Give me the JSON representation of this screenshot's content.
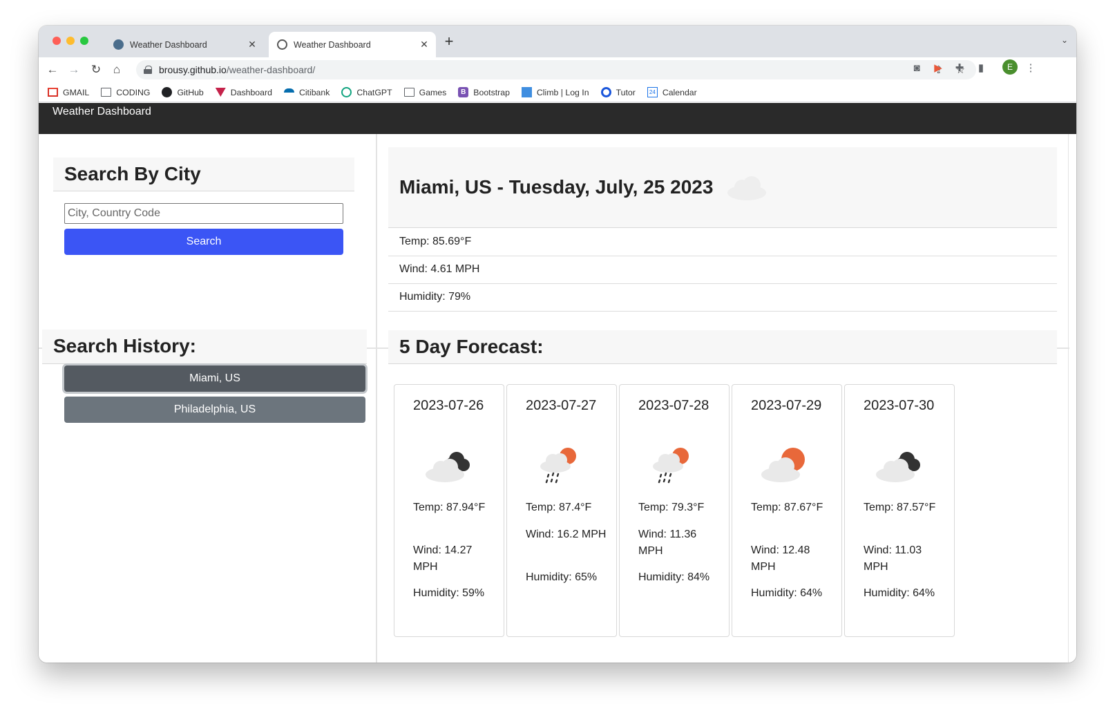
{
  "browser": {
    "tabs": [
      {
        "title": "Weather Dashboard",
        "active": false
      },
      {
        "title": "Weather Dashboard",
        "active": true
      }
    ],
    "url_host": "brousy.github.io",
    "url_path": "/weather-dashboard/",
    "profile_initial": "E",
    "bookmarks": [
      {
        "label": "GMAIL",
        "icon": "gmail-icon"
      },
      {
        "label": "CODING",
        "icon": "folder-icon"
      },
      {
        "label": "GitHub",
        "icon": "github-icon"
      },
      {
        "label": "Dashboard",
        "icon": "dashboard-icon"
      },
      {
        "label": "Citibank",
        "icon": "citibank-icon"
      },
      {
        "label": "ChatGPT",
        "icon": "chatgpt-icon"
      },
      {
        "label": "Games",
        "icon": "folder-icon"
      },
      {
        "label": "Bootstrap",
        "icon": "bootstrap-icon"
      },
      {
        "label": "Climb | Log In",
        "icon": "climb-icon"
      },
      {
        "label": "Tutor",
        "icon": "tutor-icon"
      },
      {
        "label": "Calendar",
        "icon": "calendar-icon"
      }
    ]
  },
  "app": {
    "brand": "Weather Dashboard",
    "search": {
      "heading": "Search By City",
      "placeholder": "City, Country Code",
      "value": "",
      "button_label": "Search"
    },
    "history": {
      "heading": "Search History:",
      "items": [
        "Miami, US",
        "Philadelphia, US"
      ],
      "selected_index": 0
    },
    "current": {
      "title": "Miami, US - Tuesday, July, 25 2023",
      "icon": "cloud-icon",
      "temp": "Temp: 85.69°F",
      "wind": "Wind: 4.61 MPH",
      "humidity": "Humidity: 79%"
    },
    "forecast": {
      "heading": "5 Day Forecast:",
      "days": [
        {
          "date": "2023-07-26",
          "icon": "broken-clouds-icon",
          "temp": "Temp: 87.94°F",
          "wind": "Wind: 14.27 MPH",
          "humidity": "Humidity: 59%"
        },
        {
          "date": "2023-07-27",
          "icon": "rain-sun-icon",
          "temp": "Temp: 87.4°F",
          "wind": "Wind: 16.2 MPH",
          "humidity": "Humidity: 65%"
        },
        {
          "date": "2023-07-28",
          "icon": "rain-sun-icon",
          "temp": "Temp: 79.3°F",
          "wind": "Wind: 11.36 MPH",
          "humidity": "Humidity: 84%"
        },
        {
          "date": "2023-07-29",
          "icon": "partly-cloudy-icon",
          "temp": "Temp: 87.67°F",
          "wind": "Wind: 12.48 MPH",
          "humidity": "Humidity: 64%"
        },
        {
          "date": "2023-07-30",
          "icon": "broken-clouds-icon",
          "temp": "Temp: 87.57°F",
          "wind": "Wind: 11.03 MPH",
          "humidity": "Humidity: 64%"
        }
      ]
    }
  },
  "colors": {
    "navbar": "#2a2a2a",
    "search_button": "#3b55f5",
    "history_button": "#6c757d",
    "sun": "#e8683a"
  }
}
